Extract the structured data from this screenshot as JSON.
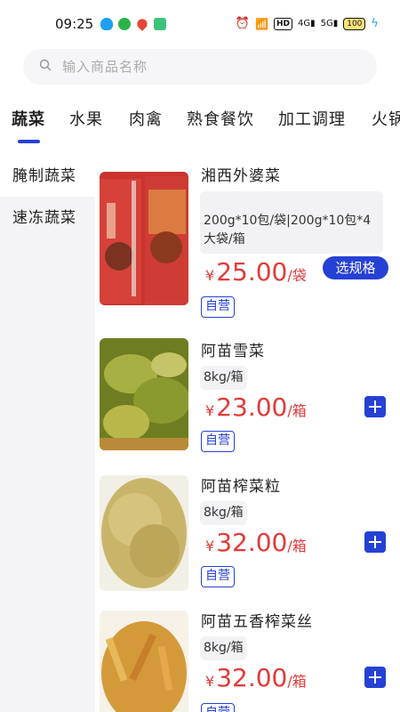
{
  "status_bar": {
    "time": "09:25",
    "hd_label": "HD",
    "net_label_1": "4G",
    "net_label_2": "5G",
    "battery": "100"
  },
  "search": {
    "placeholder": "输入商品名称"
  },
  "tabs": [
    "蔬菜",
    "水果",
    "肉禽",
    "熟食餐饮",
    "加工调理",
    "火锅"
  ],
  "active_tab": 0,
  "sidebar": [
    {
      "label": "腌制蔬菜",
      "active": true
    },
    {
      "label": "速冻蔬菜",
      "active": false
    }
  ],
  "products": [
    {
      "name": "湘西外婆菜",
      "spec": "200g*10包/袋|200g*10包*4大袋/箱",
      "currency": "¥",
      "price": "25.00",
      "unit": "/袋",
      "badge": "自营",
      "action": "选规格"
    },
    {
      "name": "阿苗雪菜",
      "spec": "8kg/箱",
      "currency": "¥",
      "price": "23.00",
      "unit": "/箱",
      "badge": "自营",
      "action": "+"
    },
    {
      "name": "阿苗榨菜粒",
      "spec": "8kg/箱",
      "currency": "¥",
      "price": "32.00",
      "unit": "/箱",
      "badge": "自营",
      "action": "+"
    },
    {
      "name": "阿苗五香榨菜丝",
      "spec": "8kg/箱",
      "currency": "¥",
      "price": "32.00",
      "unit": "/箱",
      "badge": "自营",
      "action": "+"
    }
  ],
  "colors": {
    "accent": "#2541d4",
    "price": "#e23a3a",
    "sidebar_bg": "#f4f4f6"
  }
}
